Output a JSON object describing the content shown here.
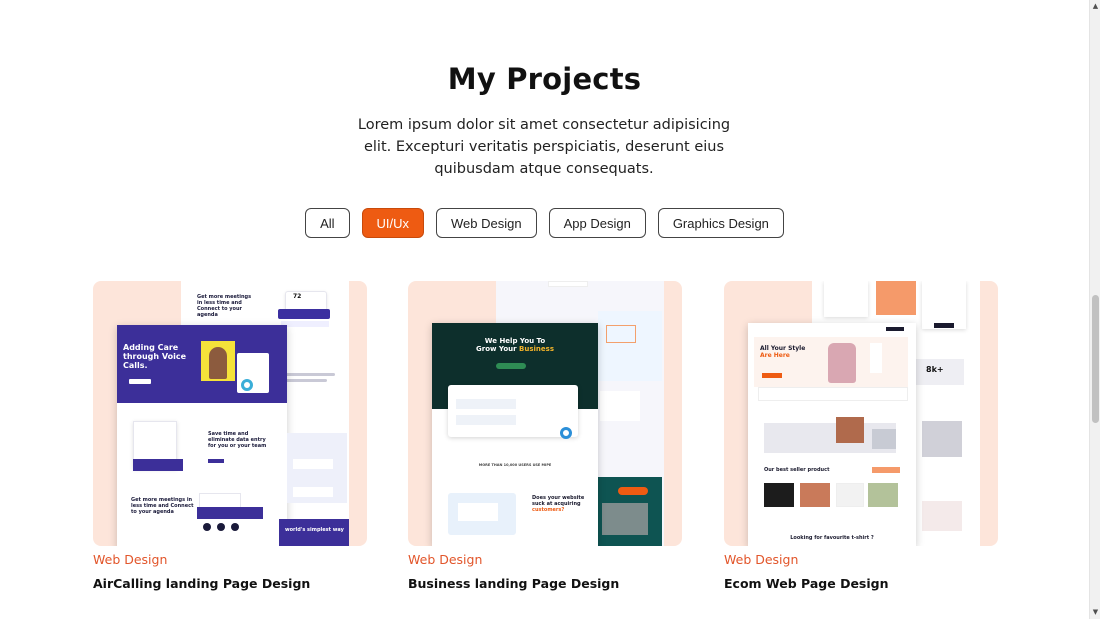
{
  "section": {
    "title": "My Projects",
    "intro": "Lorem ipsum dolor sit amet consectetur adipisicing elit. Excepturi veritatis perspiciatis, deserunt eius quibusdam atque consequats."
  },
  "filters": [
    {
      "label": "All",
      "active": false
    },
    {
      "label": "UI/Ux",
      "active": true
    },
    {
      "label": "Web Design",
      "active": false
    },
    {
      "label": "App Design",
      "active": false
    },
    {
      "label": "Graphics Design",
      "active": false
    }
  ],
  "projects": [
    {
      "category": "Web Design",
      "title": "AirCalling landing Page Design",
      "preview": {
        "hero_line1": "Adding Care",
        "hero_line2": "through Voice",
        "hero_line3": "Calls.",
        "headline_a": "Get more meetings in less time and Connect to your agenda",
        "headline_b": "Save time and eliminate data entry for you or your team",
        "headline_c": "Get more meetings in less time and Connect to your agenda",
        "stat": "72",
        "footer": "world's simplest way"
      }
    },
    {
      "category": "Web Design",
      "title": "Business landing Page Design",
      "preview": {
        "hero_line1": "We Help You To",
        "hero_line2": "Grow Your",
        "hero_accent": "Business",
        "users_line": "MORE THAN 10,000 USERS USE MIPE",
        "question": "Does your website suck at acquiring",
        "question_accent": "customers?"
      }
    },
    {
      "category": "Web Design",
      "title": "Ecom Web Page Design",
      "preview": {
        "hero_line1": "All Your Style",
        "hero_line2": "Are Here",
        "stat": "8k+",
        "section_heading": "Our best seller product",
        "footer_heading": "Looking for favourite t-shirt ?"
      }
    }
  ],
  "colors": {
    "accent": "#ee5b12",
    "card_bg": "#fde5da",
    "category": "#e2552a"
  }
}
